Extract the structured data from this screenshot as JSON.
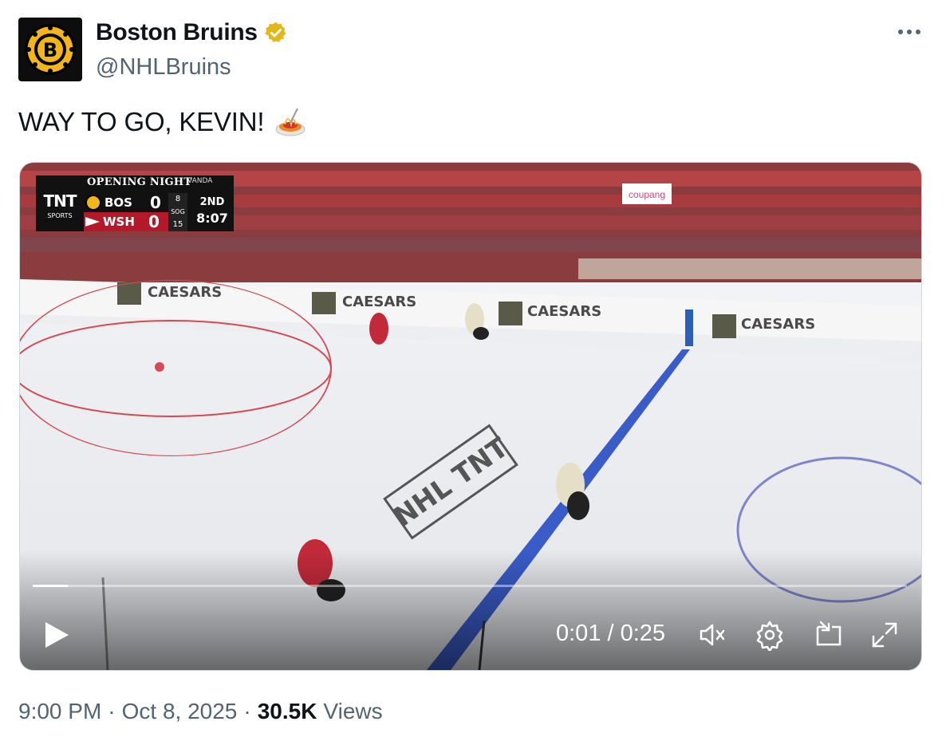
{
  "account": {
    "display_name": "Boston Bruins",
    "handle": "@NHLBruins",
    "verified_color": "#e2b719",
    "avatar_icon": "bruins-logo-icon"
  },
  "tweet": {
    "text": "WAY TO GO, KEVIN!",
    "emoji": "spaghetti-emoji"
  },
  "video": {
    "scorebug": {
      "title": "OPENING NIGHT",
      "sponsor": "VANDA",
      "network": "TNT",
      "network_sub": "SPORTS",
      "sog_label": "SOG",
      "teams": [
        {
          "abbr": "BOS",
          "score": "0",
          "sog": "8"
        },
        {
          "abbr": "WSH",
          "score": "0",
          "sog": "15"
        }
      ],
      "period": "2ND",
      "clock": "8:07"
    },
    "progress": 0.04,
    "elapsed": "0:01",
    "duration": "0:25",
    "time_display": "0:01 / 0:25",
    "controls": [
      "play-icon",
      "mute-icon",
      "settings-icon",
      "pip-icon",
      "fullscreen-icon"
    ]
  },
  "footer": {
    "time": "9:00 PM",
    "date": "Oct 8, 2025",
    "views_count": "30.5K",
    "views_label": "Views"
  },
  "colors": {
    "text_primary": "#0f1419",
    "text_secondary": "#536471",
    "border": "#cfd9de"
  }
}
